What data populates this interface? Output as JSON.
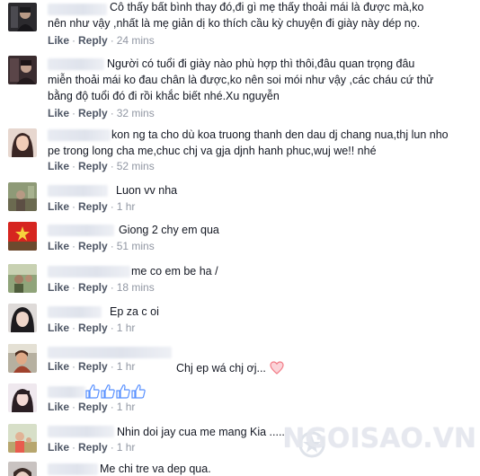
{
  "actions": {
    "like": "Like",
    "reply": "Reply"
  },
  "comments": [
    {
      "text": "Cô thấy bất bình thay đó,đi gì mẹ thấy thoải mái là được mà,ko\nnên như vậy ,nhất là mẹ giản dị ko thích cầu kỳ chuyện đi giày này dép nọ.",
      "time": "24 mins"
    },
    {
      "text": "Người có tuổi đi giày nào phù hợp thì thôi,đâu quan trọng đâu\nmiễn thoải mái ko đau chân là được,ko nên soi mói như vậy ,các cháu cứ thử\nbằng độ tuổi đó đi rồi khắc biết nhé.Xu nguyễn",
      "time": "32 mins"
    },
    {
      "text": "kon ng ta cho dù koa truong thanh den dau dj chang nua,thj lun nho\npe trong long cha me,chuc chj va gja djnh hanh phuc,wuj we!! nhé",
      "time": "52 mins"
    },
    {
      "text": "Luon vv nha",
      "time": "1 hr"
    },
    {
      "text": "Giong 2 chy em qua",
      "time": "51 mins"
    },
    {
      "text": "me co em be ha /",
      "time": "18 mins"
    },
    {
      "text": "Ep za c oi",
      "time": "1 hr"
    },
    {
      "text": "Chj ep wá chj ơj...",
      "time": "1 hr"
    },
    {
      "text": "",
      "time": "1 hr"
    },
    {
      "text": "Nhin doi jay cua me mang Kia .....",
      "time": "1 hr"
    },
    {
      "text": "Me chi tre va dep qua.",
      "time": ""
    }
  ],
  "icons": {
    "heart": "heart-icon",
    "thumbs": "thumbs-up-icon"
  },
  "colors": {
    "link": "#4e5665",
    "meta": "#9197a3",
    "text": "#141823",
    "heart": "#f27c87",
    "thumbs": "#5890ff"
  },
  "watermark": "NGOISAO.VN"
}
